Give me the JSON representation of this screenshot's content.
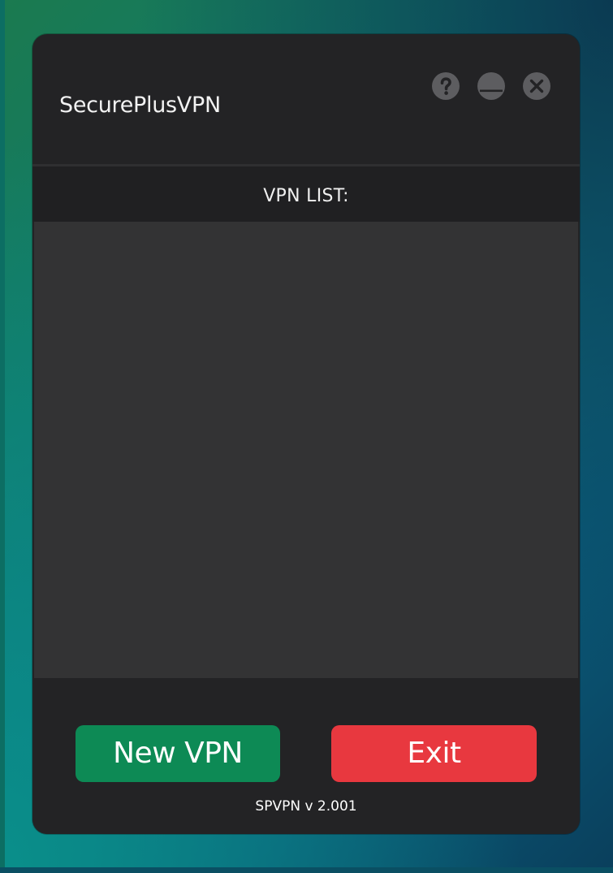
{
  "window": {
    "title": "SecurePlusVPN",
    "controls": [
      {
        "name": "help",
        "icon": "question-icon"
      },
      {
        "name": "minimize",
        "icon": "minimize-icon"
      },
      {
        "name": "close",
        "icon": "close-icon"
      }
    ]
  },
  "list": {
    "header": "VPN LIST:",
    "items": []
  },
  "footer": {
    "new_vpn_label": "New VPN",
    "exit_label": "Exit",
    "version": "SPVPN v 2.001"
  },
  "colors": {
    "window_bg": "#232325",
    "list_bg": "#333334",
    "header_bg": "#202022",
    "new_button": "#0d8a55",
    "exit_button": "#e8383f",
    "control_icon": "#5d5d60"
  }
}
